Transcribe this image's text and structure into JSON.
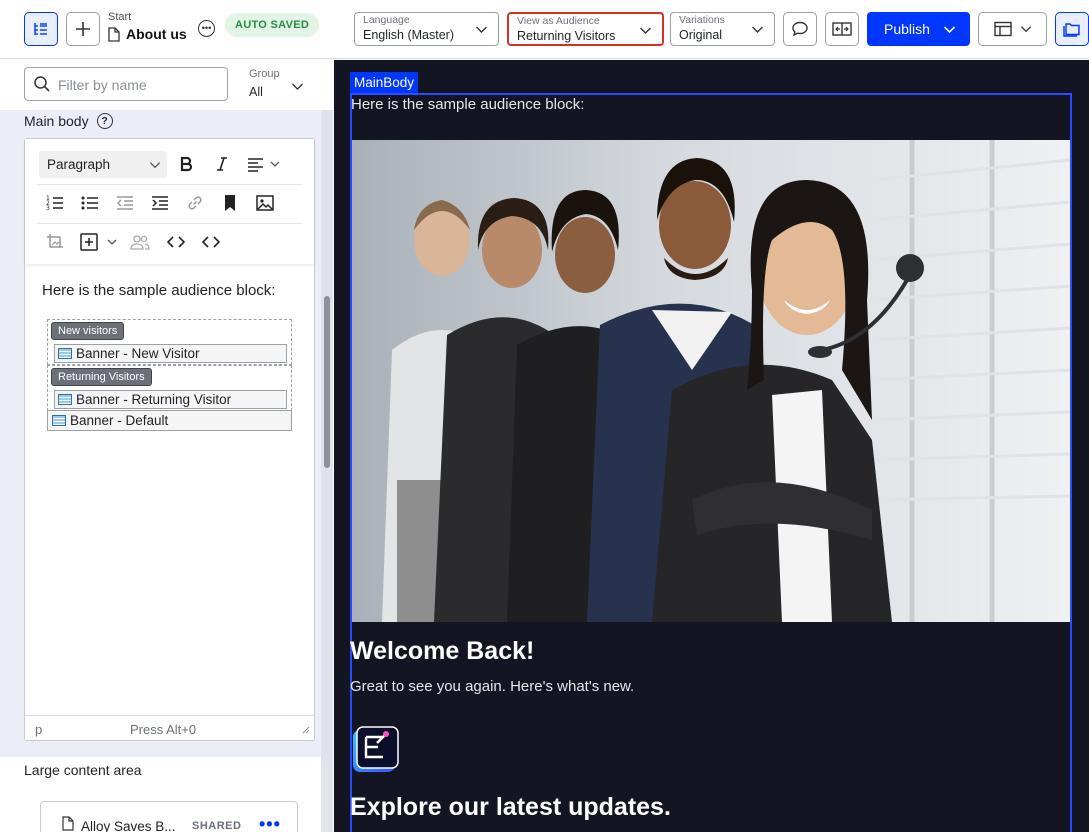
{
  "header": {
    "breadcrumb_small": "Start",
    "page_title": "About us",
    "autosaved": "AUTO SAVED",
    "language": {
      "label": "Language",
      "value": "English (Master)"
    },
    "audience": {
      "label": "View as Audience",
      "value": "Returning Visitors"
    },
    "variations": {
      "label": "Variations",
      "value": "Original"
    },
    "publish_label": "Publish"
  },
  "sidebar": {
    "filter_placeholder": "Filter by name",
    "group_label": "Group",
    "group_value": "All",
    "main_body_label": "Main body",
    "editor": {
      "block_format": "Paragraph",
      "content_text": "Here is the sample audience block:",
      "audiences": [
        {
          "tag": "New visitors",
          "item": "Banner - New Visitor"
        },
        {
          "tag": "Returning Visitors",
          "item": "Banner - Returning Visitor"
        }
      ],
      "default_item": "Banner - Default",
      "status_tag": "p",
      "status_hint": "Press Alt+0"
    },
    "large_content_label": "Large content area",
    "large_content_item": {
      "name": "Alloy Saves B...",
      "badge": "SHARED"
    }
  },
  "preview": {
    "block_tag": "MainBody",
    "intro_text": "Here is the sample audience block:",
    "heading": "Welcome Back!",
    "subtext": "Great to see you again. Here's what's new.",
    "heading2": "Explore our latest updates."
  },
  "colors": {
    "accent": "#0037ff",
    "highlight_border": "#d93025",
    "preview_bg": "#131522",
    "autosaved_bg": "#e1f4e6",
    "autosaved_text": "#2a8a49"
  }
}
